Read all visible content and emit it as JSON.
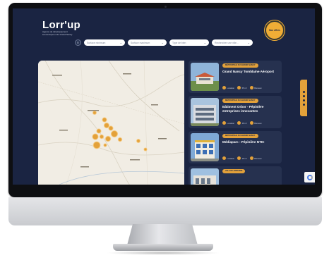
{
  "brand": {
    "logo": "Lorr'up",
    "tagline": "Agence de développement économique et du Grand Nancy"
  },
  "header": {
    "cta_label": "Nos offres"
  },
  "filters": [
    {
      "placeholder": "Surface minimum"
    },
    {
      "placeholder": "Surface maximum"
    },
    {
      "placeholder": "Type de bien"
    },
    {
      "placeholder": "Rechercher une ville..."
    }
  ],
  "listings": [
    {
      "tag": "MÉTROPOLE DU GRAND NANCY",
      "title": "Grand Nancy Tomblaine Aéroport",
      "meta": [
        "Location",
        "55 m²",
        "Bureaux"
      ]
    },
    {
      "tag": "MÉTROPOLE DU GRAND NANCY",
      "title": "Bâtiment Orbor - Pépinière entreprises innovantes",
      "meta": [
        "Location",
        "18 m²",
        "Bureaux"
      ]
    },
    {
      "tag": "MÉTROPOLE DU GRAND NANCY",
      "title": "Médiaparc - Pépinière NTIC",
      "meta": [
        "Location",
        "18 m²",
        "Bureaux"
      ]
    },
    {
      "tag": "VAL DE LORRAINE",
      "title": "",
      "meta": []
    }
  ],
  "colors": {
    "background": "#1a2442",
    "card": "#26314f",
    "accent": "#e3a13a"
  }
}
